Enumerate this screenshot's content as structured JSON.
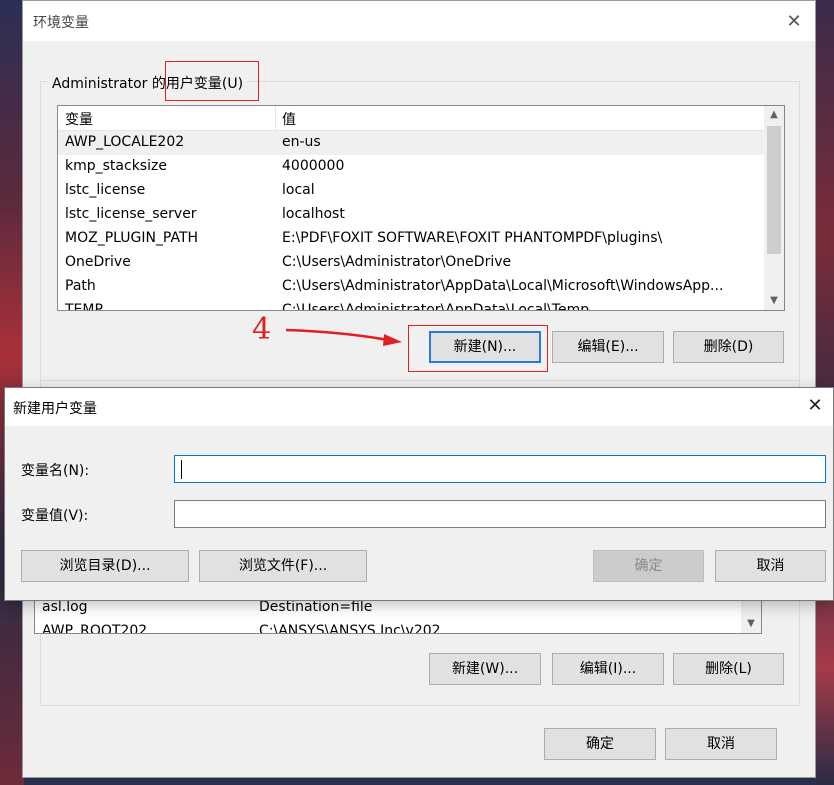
{
  "main_window": {
    "title": "环境变量",
    "close_glyph": "✕",
    "user_group_label_prefix": "Administrator 的",
    "user_group_label_highlight": "用户变量(U)",
    "columns": [
      "变量",
      "值"
    ],
    "user_variables": [
      {
        "name": "AWP_LOCALE202",
        "value": "en-us"
      },
      {
        "name": "kmp_stacksize",
        "value": "4000000"
      },
      {
        "name": "lstc_license",
        "value": "local"
      },
      {
        "name": "lstc_license_server",
        "value": "localhost"
      },
      {
        "name": "MOZ_PLUGIN_PATH",
        "value": "E:\\PDF\\FOXIT SOFTWARE\\FOXIT PHANTOMPDF\\plugins\\"
      },
      {
        "name": "OneDrive",
        "value": "C:\\Users\\Administrator\\OneDrive"
      },
      {
        "name": "Path",
        "value": "C:\\Users\\Administrator\\AppData\\Local\\Microsoft\\WindowsApp..."
      },
      {
        "name": "TEMP",
        "value": "C:\\Users\\Administrator\\AppData\\Local\\Temp"
      }
    ],
    "user_buttons": {
      "new": "新建(N)...",
      "edit": "编辑(E)...",
      "delete": "删除(D)"
    },
    "system_variables_visible": [
      {
        "name": "asl.log",
        "value": "Destination=file"
      },
      {
        "name": "AWP_ROOT202",
        "value": "C:\\ANSYS\\ANSYS Inc\\v202"
      }
    ],
    "system_buttons": {
      "new": "新建(W)...",
      "edit": "编辑(I)...",
      "delete": "删除(L)"
    },
    "footer_buttons": {
      "ok": "确定",
      "cancel": "取消"
    }
  },
  "annotation": {
    "step_number": "4",
    "color": "#e02020"
  },
  "dialog": {
    "title": "新建用户变量",
    "close_glyph": "✕",
    "name_label": "变量名(N):",
    "value_label": "变量值(V):",
    "name_value": "",
    "value_value": "",
    "browse_dir_button": "浏览目录(D)...",
    "browse_file_button": "浏览文件(F)...",
    "ok_button": "确定",
    "cancel_button": "取消"
  },
  "icons": {
    "scroll_up": "▲",
    "scroll_down": "▼"
  },
  "colors": {
    "focus_blue": "#2b79d8",
    "input_focus": "#0078d7",
    "window_bg": "#f0f0f0"
  }
}
